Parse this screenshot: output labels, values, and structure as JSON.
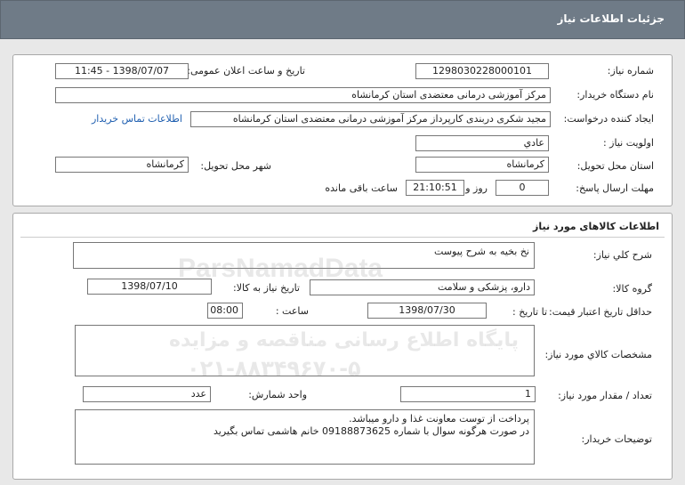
{
  "header": {
    "title": "جزئیات اطلاعات نیاز"
  },
  "info": {
    "need_number_label": "شماره نیاز:",
    "need_number": "1298030228000101",
    "announce_label": "تاریخ و ساعت اعلان عمومی:",
    "announce_value": "1398/07/07 - 11:45",
    "buyer_org_label": "نام دستگاه خریدار:",
    "buyer_org": "مرکز آموزشی درمانی معتضدی استان کرمانشاه",
    "creator_label": "ایجاد کننده درخواست:",
    "creator": "مجید شکری دربندی کارپرداز مرکز آموزشی درمانی معتضدی استان کرمانشاه",
    "contact_link": "اطلاعات تماس خریدار",
    "priority_label": "اولویت نیاز :",
    "priority": "عادي",
    "province_label": "استان محل تحویل:",
    "province": "کرمانشاه",
    "city_label": "شهر محل تحویل:",
    "city": "کرمانشاه",
    "deadline_label": "مهلت ارسال پاسخ:",
    "days": "0",
    "days_suffix": "روز و",
    "time": "21:10:51",
    "time_suffix": "ساعت باقی مانده"
  },
  "goods": {
    "section_title": "اطلاعات کالاهای مورد نیاز",
    "general_desc_label": "شرح کلي نیاز:",
    "general_desc": "نخ بخیه به شرح پیوست",
    "group_label": "گروه کالا:",
    "group": "دارو، پزشکی و سلامت",
    "need_date_label": "تاریخ نیاز به کالا:",
    "need_date": "1398/07/10",
    "min_validity_label": "حداقل تاریخ اعتبار قیمت:",
    "until_date_label": "تا تاریخ :",
    "until_date": "1398/07/30",
    "hour_label": "ساعت :",
    "hour": "08:00",
    "specs_label": "مشخصات کالاي مورد نیاز:",
    "specs": "",
    "qty_label": "تعداد / مقدار مورد نیاز:",
    "qty": "1",
    "unit_label": "واحد شمارش:",
    "unit": "عدد",
    "buyer_notes_label": "توضیحات خریدار:",
    "buyer_notes_line1": "پرداخت از توست معاونت غذا و دارو میباشد.",
    "buyer_notes_line2": "در صورت هرگونه سوال با شماره 09188873625 خانم هاشمی تماس بگیرید"
  },
  "watermark": {
    "brand": "ParsNamadData",
    "line1": "پایگاه اطلاع رسانی مناقصه و مزایده",
    "phone": "۰۲۱-۸۸۳۴۹۶۷۰-۵"
  }
}
